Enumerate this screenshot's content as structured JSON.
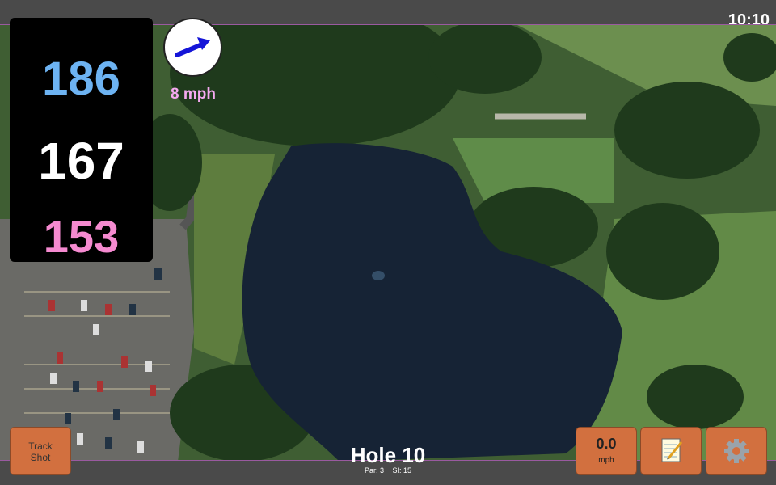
{
  "status": {
    "time": "10:10"
  },
  "yardages": {
    "back": "186",
    "middle": "167",
    "front": "153",
    "colors": {
      "back": "#6db3f2",
      "middle": "#ffffff",
      "front": "#f58ad0"
    }
  },
  "wind": {
    "speed": "8 mph",
    "direction_icon": "arrow-right-up-icon",
    "arrow_color": "#1515d8"
  },
  "hole": {
    "title": "Hole 10",
    "par": "Par: 3",
    "si": "SI: 15"
  },
  "buttons": {
    "track_shot": [
      "Track",
      "Shot"
    ],
    "speed_value": "0.0",
    "speed_unit": "mph",
    "notes_icon": "notepad-icon",
    "settings_icon": "gear-icon",
    "accent": "#d2703f"
  }
}
